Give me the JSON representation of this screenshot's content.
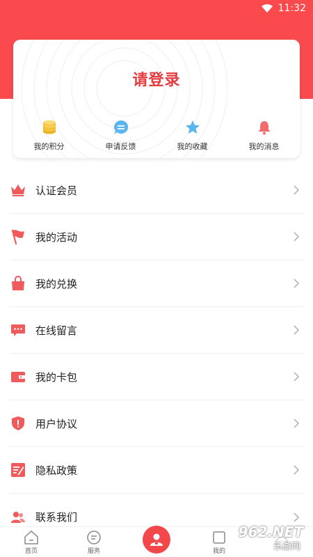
{
  "status_bar": {
    "time": "11:32"
  },
  "header": {
    "login_text": "请登录"
  },
  "quick_actions": [
    {
      "label": "我的积分",
      "icon": "coins-icon"
    },
    {
      "label": "申请反馈",
      "icon": "chat-bubble-icon"
    },
    {
      "label": "我的收藏",
      "icon": "star-icon"
    },
    {
      "label": "我的消息",
      "icon": "bell-icon"
    }
  ],
  "menu": [
    {
      "label": "认证会员",
      "icon": "crown-icon"
    },
    {
      "label": "我的活动",
      "icon": "flag-icon"
    },
    {
      "label": "我的兑换",
      "icon": "shopping-bag-icon"
    },
    {
      "label": "在线留言",
      "icon": "message-icon"
    },
    {
      "label": "我的卡包",
      "icon": "wallet-icon"
    },
    {
      "label": "用户协议",
      "icon": "shield-icon"
    },
    {
      "label": "隐私政策",
      "icon": "document-edit-icon"
    },
    {
      "label": "联系我们",
      "icon": "contacts-icon"
    }
  ],
  "tabbar": [
    {
      "label": "首页",
      "icon": "home-icon"
    },
    {
      "label": "服务",
      "icon": "service-icon"
    },
    {
      "label": "",
      "icon": "user-center-icon"
    },
    {
      "label": "我的",
      "icon": "profile-icon"
    },
    {
      "label": "",
      "icon": "more-icon"
    }
  ],
  "watermark": {
    "text": "962.NET",
    "sub": "乐游网"
  },
  "colors": {
    "brand_red": "#fb4a4d",
    "accent_red": "#e43b3f",
    "gold": "#f5c542",
    "blue": "#5bb6f0"
  }
}
